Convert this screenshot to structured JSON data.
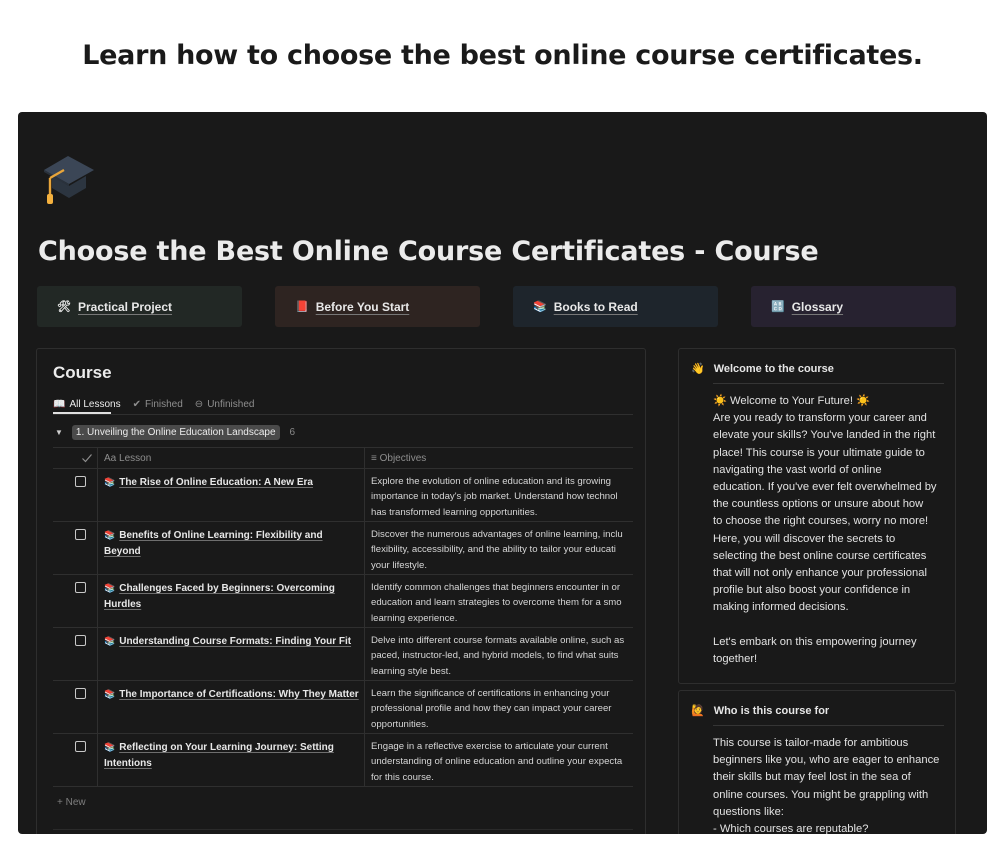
{
  "headline": "Learn how to choose the best online course certificates.",
  "page": {
    "icon": "graduation-cap-icon",
    "title": "Choose the Best Online Course Certificates - Course"
  },
  "quick_links": [
    {
      "icon": "🛠",
      "label": "Practical Project",
      "bg": "#222825"
    },
    {
      "icon": "📕",
      "label": "Before You Start",
      "bg": "#2e2421"
    },
    {
      "icon": "📚",
      "label": "Books to Read",
      "bg": "#1e252c"
    },
    {
      "icon": "🔠",
      "label": "Glossary",
      "bg": "#272230"
    }
  ],
  "course": {
    "title": "Course",
    "tabs": [
      {
        "icon": "📖",
        "label": "All Lessons"
      },
      {
        "icon": "✔",
        "label": "Finished"
      },
      {
        "icon": "⊖",
        "label": "Unfinished"
      }
    ],
    "group": {
      "toggle": "▼",
      "label": "1. Unveiling the Online Education Landscape",
      "count": "6"
    },
    "columns": {
      "lesson": "Lesson",
      "lesson_prefix": "Aa",
      "objectives": "Objectives"
    },
    "rows": [
      {
        "lesson": "The Rise of Online Education: A New Era",
        "objective_lines": [
          "Explore the evolution of online education and its growing",
          "importance in today's job market. Understand how technol",
          "has transformed learning opportunities."
        ]
      },
      {
        "lesson": "Benefits of Online Learning: Flexibility and Beyond",
        "objective_lines": [
          "Discover the numerous advantages of online learning, inclu",
          "flexibility, accessibility, and the ability to tailor your educati",
          "your lifestyle."
        ]
      },
      {
        "lesson": "Challenges Faced by Beginners: Overcoming Hurdles",
        "objective_lines": [
          "Identify common challenges that beginners encounter in or",
          "education and learn strategies to overcome them for a smo",
          "learning experience."
        ]
      },
      {
        "lesson": "Understanding Course Formats: Finding Your Fit",
        "objective_lines": [
          "Delve into different course formats available online, such as",
          "paced, instructor-led, and hybrid models, to find what suits",
          "learning style best."
        ]
      },
      {
        "lesson": "The Importance of Certifications: Why They Matter",
        "objective_lines": [
          "Learn the significance of certifications in enhancing your",
          "professional profile and how they can impact your career",
          "opportunities."
        ]
      },
      {
        "lesson": "Reflecting on Your Learning Journey: Setting Intentions",
        "objective_lines": [
          "Engage in a reflective exercise to articulate your current",
          "understanding of online education and outline your expecta",
          "for this course."
        ]
      }
    ],
    "new_label": "+ New"
  },
  "welcome": {
    "icon": "👋",
    "title": "Welcome to the course",
    "lines": [
      "☀️ Welcome to Your Future! ☀️",
      "Are you ready to transform your career and",
      "elevate your skills? You've landed in the right",
      "place! This course is your ultimate guide to",
      "navigating the vast world of online",
      "education. If you've ever felt overwhelmed by",
      "the countless options or unsure about how",
      "to choose the right courses, worry no more!",
      "Here, you will discover the secrets to",
      "selecting the best online course certificates",
      "that will not only enhance your professional",
      "profile but also boost your confidence in",
      "making informed decisions."
    ],
    "closing_lines": [
      "Let's embark on this empowering journey",
      "together!"
    ]
  },
  "who_for": {
    "icon": "🙋",
    "title": "Who is this course for",
    "lines": [
      "This course is tailor-made for ambitious",
      "beginners like you, who are eager to enhance",
      "their skills but may feel lost in the sea of",
      "online courses. You might be grappling with",
      "questions like:",
      "- Which courses are reputable?"
    ]
  }
}
